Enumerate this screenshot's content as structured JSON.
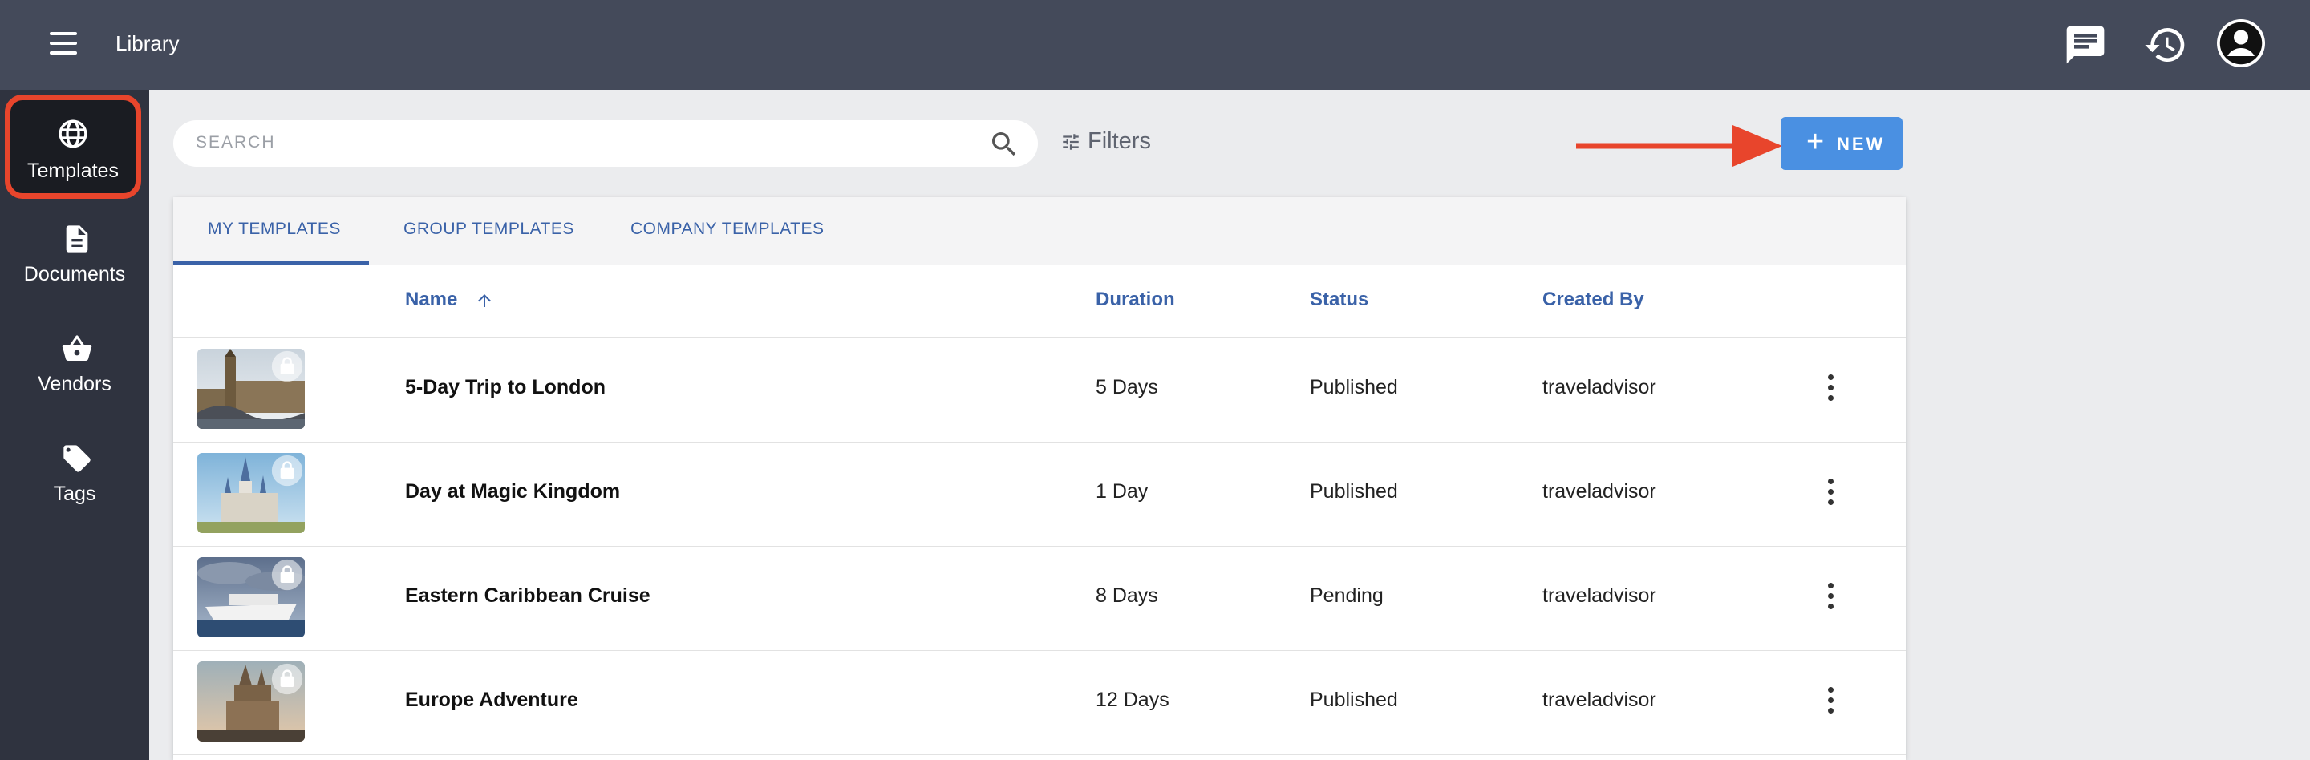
{
  "header": {
    "title": "Library"
  },
  "sidebar": {
    "items": [
      {
        "label": "Templates",
        "icon": "globe-icon"
      },
      {
        "label": "Documents",
        "icon": "document-icon"
      },
      {
        "label": "Vendors",
        "icon": "basket-icon"
      },
      {
        "label": "Tags",
        "icon": "tag-icon"
      }
    ],
    "active": "Templates"
  },
  "toolbar": {
    "search_placeholder": "SEARCH",
    "filters_label": "Filters",
    "new_label": "NEW"
  },
  "tabs": [
    "MY TEMPLATES",
    "GROUP TEMPLATES",
    "COMPANY TEMPLATES"
  ],
  "table": {
    "columns": [
      "Name",
      "Duration",
      "Status",
      "Created By"
    ],
    "sort": {
      "column": "Name",
      "direction": "ascending"
    },
    "rows": [
      {
        "name": "5-Day Trip to London",
        "duration": "5 Days",
        "status": "Published",
        "created_by": "traveladvisor",
        "thumbnail": "london-photo"
      },
      {
        "name": "Day at Magic Kingdom",
        "duration": "1 Day",
        "status": "Published",
        "created_by": "traveladvisor",
        "thumbnail": "castle-photo"
      },
      {
        "name": "Eastern Caribbean Cruise",
        "duration": "8 Days",
        "status": "Pending",
        "created_by": "traveladvisor",
        "thumbnail": "cruise-ship-photo"
      },
      {
        "name": "Europe Adventure",
        "duration": "12 Days",
        "status": "Published",
        "created_by": "traveladvisor",
        "thumbnail": "cathedral-photo"
      }
    ]
  },
  "colors": {
    "topbar": "#444a5a",
    "sidebar": "#2f333f",
    "accent": "#3a62a8",
    "new_button": "#4a90e2",
    "highlight": "#e8452c"
  }
}
